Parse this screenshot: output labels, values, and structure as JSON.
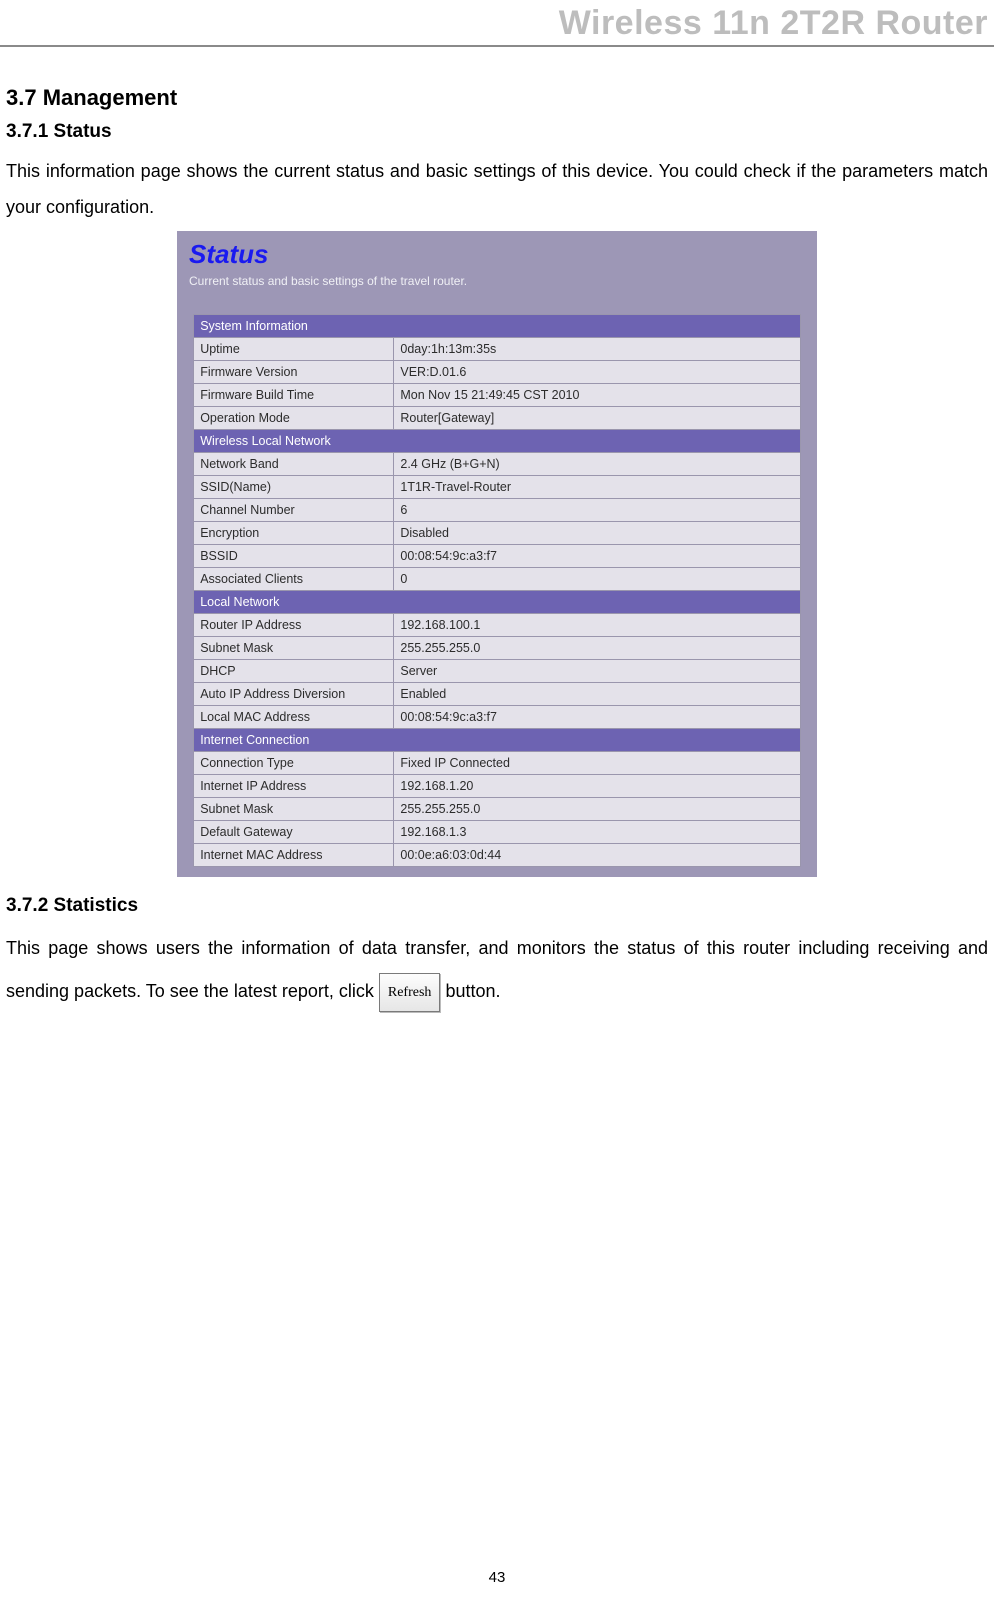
{
  "header": {
    "title": "Wireless 11n 2T2R Router"
  },
  "sec37": {
    "num_title": "3.7    Management",
    "s1_title": "3.7.1 Status",
    "s1_para": "This information page shows the current status and basic settings of this device. You could check if the parameters match your configuration.",
    "s2_title": "3.7.2 Statistics",
    "s2_para_a": "This page shows users the information of data transfer, and monitors the status of this router including receiving and sending packets. To see the latest report, click ",
    "s2_para_b": " button."
  },
  "status_panel": {
    "title": "Status",
    "subtitle": "Current status and basic settings of the travel router.",
    "sections": {
      "sysinfo": {
        "header": "System Information",
        "rows": [
          {
            "label": "Uptime",
            "value": "0day:1h:13m:35s"
          },
          {
            "label": "Firmware Version",
            "value": "VER:D.01.6"
          },
          {
            "label": "Firmware Build Time",
            "value": "Mon Nov 15 21:49:45 CST 2010"
          },
          {
            "label": "Operation Mode",
            "value": "Router[Gateway]"
          }
        ]
      },
      "wlan": {
        "header": "Wireless Local Network",
        "rows": [
          {
            "label": "Network Band",
            "value": "2.4 GHz (B+G+N)"
          },
          {
            "label": "SSID(Name)",
            "value": "1T1R-Travel-Router"
          },
          {
            "label": "Channel Number",
            "value": "6"
          },
          {
            "label": "Encryption",
            "value": "Disabled"
          },
          {
            "label": "BSSID",
            "value": "00:08:54:9c:a3:f7"
          },
          {
            "label": "Associated Clients",
            "value": "0"
          }
        ]
      },
      "lan": {
        "header": "Local Network",
        "rows": [
          {
            "label": "Router IP Address",
            "value": "192.168.100.1"
          },
          {
            "label": "Subnet Mask",
            "value": "255.255.255.0"
          },
          {
            "label": "DHCP",
            "value": "Server"
          },
          {
            "label": "Auto IP Address Diversion",
            "value": "Enabled"
          },
          {
            "label": "Local MAC Address",
            "value": "00:08:54:9c:a3:f7"
          }
        ]
      },
      "wan": {
        "header": "Internet Connection",
        "rows": [
          {
            "label": "Connection Type",
            "value": "Fixed IP Connected"
          },
          {
            "label": "Internet IP Address",
            "value": "192.168.1.20"
          },
          {
            "label": "Subnet Mask",
            "value": "255.255.255.0"
          },
          {
            "label": "Default Gateway",
            "value": "192.168.1.3"
          },
          {
            "label": "Internet MAC Address",
            "value": "00:0e:a6:03:0d:44"
          }
        ]
      }
    }
  },
  "refresh_label": "Refresh",
  "page_number": "43"
}
